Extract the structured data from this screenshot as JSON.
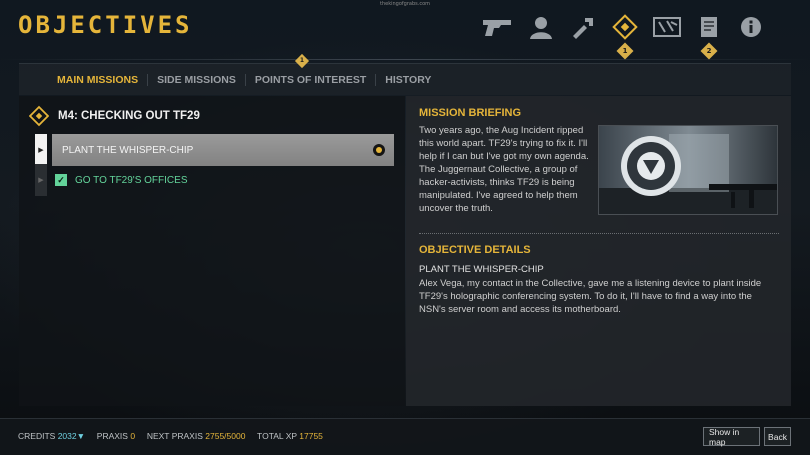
{
  "watermark": "thekingofgrabs.com",
  "title": "OBJECTIVES",
  "nav": {
    "icons": [
      "pistol-icon",
      "character-icon",
      "augmentation-icon",
      "objectives-icon",
      "map-icon",
      "journal-icon",
      "info-icon"
    ],
    "badges": [
      "1",
      "2"
    ],
    "active": "objectives-icon"
  },
  "tabs": {
    "badge": "1",
    "items": [
      "MAIN MISSIONS",
      "SIDE MISSIONS",
      "POINTS OF INTEREST",
      "HISTORY"
    ],
    "active": "MAIN MISSIONS"
  },
  "mission": {
    "title": "M4: CHECKING OUT TF29",
    "objectives": [
      {
        "label": "PLANT THE WHISPER-CHIP",
        "state": "current"
      },
      {
        "label": "GO TO TF29'S OFFICES",
        "state": "completed"
      }
    ]
  },
  "briefing": {
    "heading": "MISSION BRIEFING",
    "text": "Two years ago, the Aug Incident ripped this world apart. TF29's trying to fix it. I'll help if I can but I've got my own agenda. The Juggernaut Collective, a group of hacker-activists, thinks TF29 is being manipulated. I've agreed to help them uncover the truth."
  },
  "details": {
    "heading": "OBJECTIVE DETAILS",
    "subtitle": "PLANT THE WHISPER-CHIP",
    "text": "Alex Vega, my contact in the Collective, gave me a listening device to plant inside TF29's holographic conferencing system. To do it, I'll have to find a way into the NSN's server room and access its motherboard."
  },
  "footer": {
    "credits_label": "CREDITS",
    "credits_value": "2032",
    "praxis_label": "PRAXIS",
    "praxis_value": "0",
    "next_praxis_label": "NEXT PRAXIS",
    "next_praxis_value": "2755/5000",
    "total_xp_label": "TOTAL XP",
    "total_xp_value": "17755",
    "show_in_map": "Show in map",
    "back": "Back"
  },
  "colors": {
    "accent": "#e5b53a",
    "completed": "#63d39a",
    "credits": "#6fd0e0"
  }
}
